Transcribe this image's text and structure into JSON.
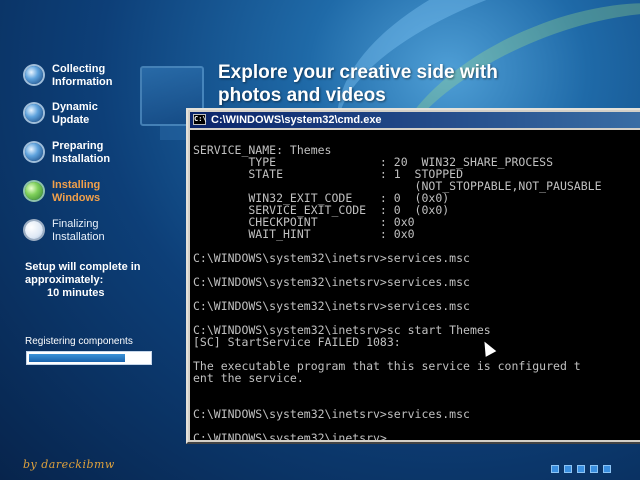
{
  "setup": {
    "steps": [
      {
        "label_line1": "Collecting",
        "label_line2": "Information",
        "state": "done"
      },
      {
        "label_line1": "Dynamic",
        "label_line2": "Update",
        "state": "done"
      },
      {
        "label_line1": "Preparing",
        "label_line2": "Installation",
        "state": "done"
      },
      {
        "label_line1": "Installing",
        "label_line2": "Windows",
        "state": "active"
      },
      {
        "label_line1": "Finalizing",
        "label_line2": "Installation",
        "state": "pending"
      }
    ],
    "eta_line1": "Setup will complete in",
    "eta_line2": "approximately:",
    "eta_minutes": "10 minutes",
    "status_label": "Registering components",
    "progress_fraction": 0.8,
    "headline_line1": "Explore your creative side with",
    "headline_line2": "photos and videos",
    "credit": "by dareckibmw"
  },
  "cmd": {
    "title": "C:\\WINDOWS\\system32\\cmd.exe",
    "icon_text": "C:\\",
    "lines": [
      "",
      "SERVICE_NAME: Themes",
      "        TYPE               : 20  WIN32_SHARE_PROCESS",
      "        STATE              : 1  STOPPED",
      "                                (NOT_STOPPABLE,NOT_PAUSABLE",
      "        WIN32_EXIT_CODE    : 0  (0x0)",
      "        SERVICE_EXIT_CODE  : 0  (0x0)",
      "        CHECKPOINT         : 0x0",
      "        WAIT_HINT          : 0x0",
      "",
      "C:\\WINDOWS\\system32\\inetsrv>services.msc",
      "",
      "C:\\WINDOWS\\system32\\inetsrv>services.msc",
      "",
      "C:\\WINDOWS\\system32\\inetsrv>services.msc",
      "",
      "C:\\WINDOWS\\system32\\inetsrv>sc start Themes",
      "[SC] StartService FAILED 1083:",
      "",
      "The executable program that this service is configured t",
      "ent the service.",
      "",
      "",
      "C:\\WINDOWS\\system32\\inetsrv>services.msc",
      "",
      "C:\\WINDOWS\\system32\\inetsrv>"
    ]
  },
  "colors": {
    "active_step": "#f2a04a",
    "console_text": "#c0c0c0",
    "titlebar": "#0a246a"
  }
}
